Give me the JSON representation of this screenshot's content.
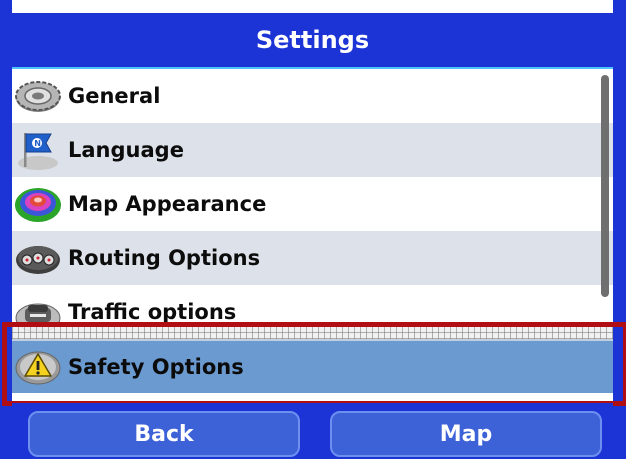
{
  "header": {
    "title": "Settings"
  },
  "settings_items": [
    {
      "label": "General",
      "icon": "gear-icon"
    },
    {
      "label": "Language",
      "icon": "language-flag-icon"
    },
    {
      "label": "Map Appearance",
      "icon": "map-appearance-icon"
    },
    {
      "label": "Routing Options",
      "icon": "routing-options-icon"
    },
    {
      "label": "Traffic options",
      "icon": "traffic-car-icon"
    },
    {
      "label": "Safety Options",
      "icon": "warning-icon"
    }
  ],
  "selected_item": "Safety Options",
  "footer": {
    "back_label": "Back",
    "map_label": "Map"
  },
  "colors": {
    "header_bg": "#1c33d6",
    "selected_row": "#6b9ad0",
    "alt_row": "#dce1ea",
    "highlight_border": "#b00e12"
  }
}
